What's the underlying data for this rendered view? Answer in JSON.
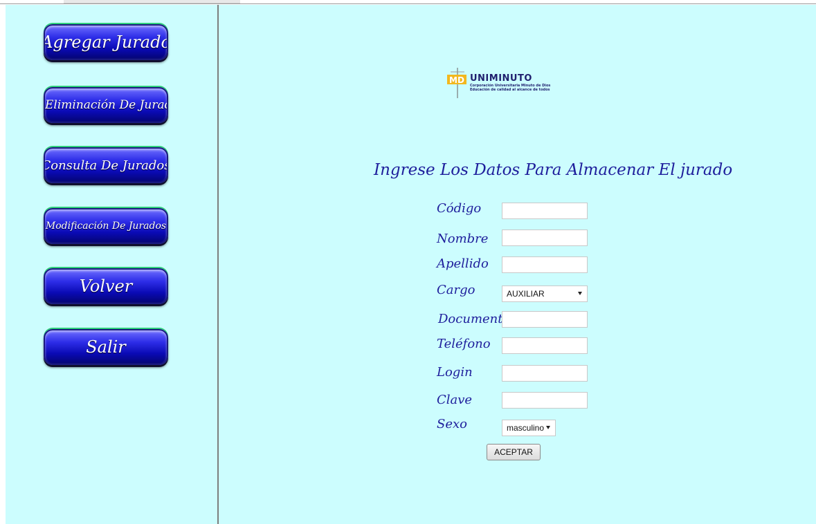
{
  "sidebar": {
    "items": [
      {
        "label": "Agregar Jurado"
      },
      {
        "label": "Eliminación De Jurados"
      },
      {
        "label": "Consulta De Jurados"
      },
      {
        "label": "Modificación De Jurados"
      },
      {
        "label": "Volver"
      },
      {
        "label": "Salir"
      }
    ]
  },
  "logo": {
    "mark": "MD",
    "name": "UNIMINUTO",
    "line1": "Corporación Universitaria Minuto de Dios",
    "line2": "Educación de calidad al alcance de todos"
  },
  "form": {
    "title": "Ingrese Los Datos Para Almacenar El jurado",
    "fields": [
      {
        "label": "Código",
        "value": ""
      },
      {
        "label": "Nombre",
        "value": ""
      },
      {
        "label": "Apellido",
        "value": ""
      },
      {
        "label": "Cargo",
        "value": "AUXILIAR"
      },
      {
        "label": "Documento",
        "value": ""
      },
      {
        "label": "Teléfono",
        "value": ""
      },
      {
        "label": "Login",
        "value": ""
      },
      {
        "label": "Clave",
        "value": ""
      },
      {
        "label": "Sexo",
        "value": "masculino"
      }
    ],
    "submit_label": "ACEPTAR"
  },
  "colors": {
    "background": "#ccfdfe",
    "label_text": "#1e1e9c",
    "button_blue": "#0a0ab4",
    "button_rim": "#2fd07a"
  }
}
